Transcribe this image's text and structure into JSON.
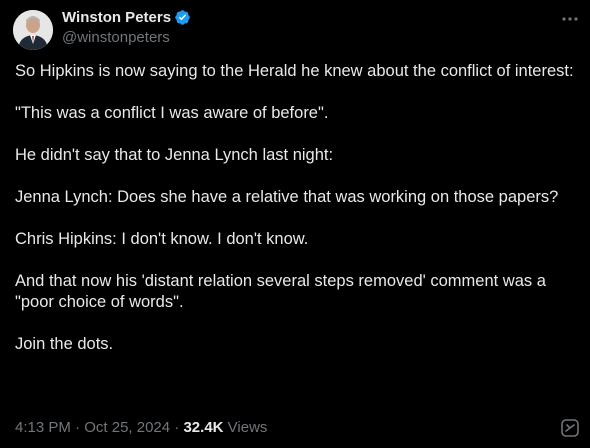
{
  "author": {
    "name": "Winston Peters",
    "handle": "@winstonpeters",
    "verified": true,
    "avatar_icon": "user-photo"
  },
  "icons": {
    "verified": "verified-badge-icon",
    "more": "more-options-icon",
    "grok": "grok-icon"
  },
  "colors": {
    "background": "#000000",
    "text": "#e7e9ea",
    "secondary": "#71767b",
    "verified": "#1d9bf0"
  },
  "tweet": {
    "paragraphs": [
      "So Hipkins is now saying to the Herald he knew about the conflict of interest:",
      "\"This was a conflict I was aware of before\".",
      "He didn't say that to Jenna Lynch last night:",
      "Jenna Lynch: Does she have a relative that was working on those papers?",
      "Chris Hipkins:  I don't know. I don't know.",
      "And that now his 'distant relation several steps removed' comment was a \"poor choice of words\".",
      "Join the dots."
    ]
  },
  "meta": {
    "time": "4:13 PM",
    "separator": " · ",
    "date": "Oct 25, 2024",
    "views_count": "32.4K",
    "views_label": "Views"
  }
}
